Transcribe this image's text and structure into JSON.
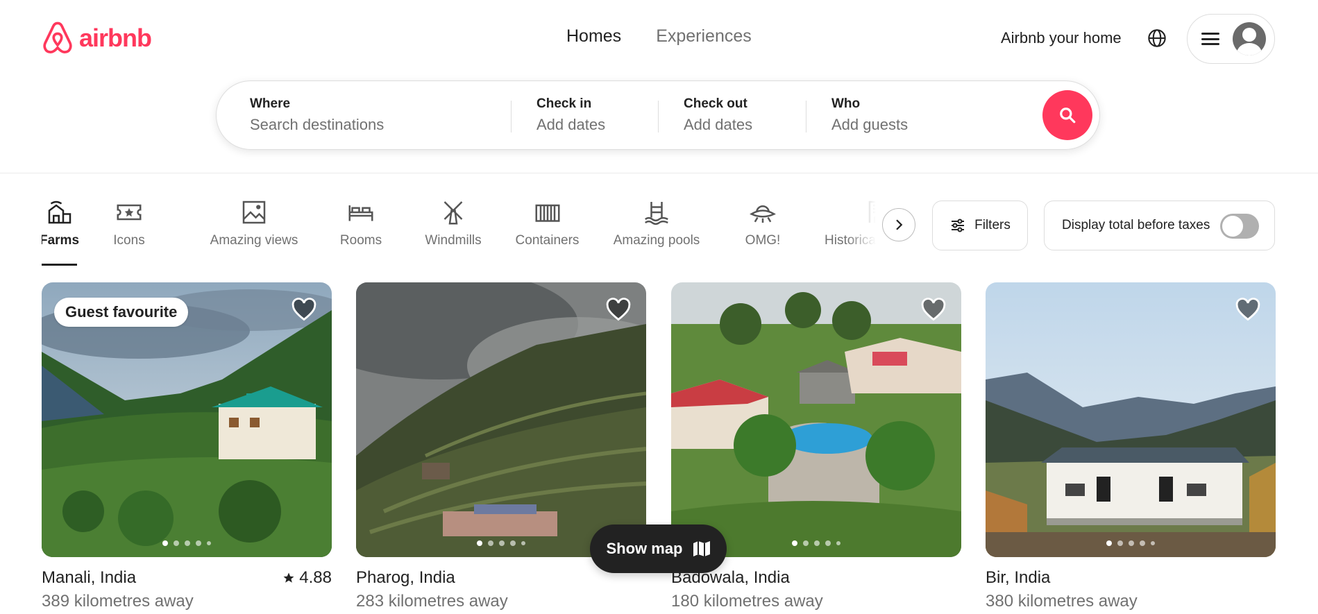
{
  "brand": {
    "name": "airbnb",
    "color": "#ff385c"
  },
  "nav": {
    "tabs": [
      {
        "label": "Homes"
      },
      {
        "label": "Experiences"
      }
    ]
  },
  "header": {
    "host_link": "Airbnb your home",
    "globe_icon": "globe-icon",
    "menu_icon": "hamburger-icon"
  },
  "search": {
    "where": {
      "label": "Where",
      "placeholder": "Search destinations"
    },
    "check_in": {
      "label": "Check in",
      "placeholder": "Add dates"
    },
    "check_out": {
      "label": "Check out",
      "placeholder": "Add dates"
    },
    "who": {
      "label": "Who",
      "placeholder": "Add guests"
    }
  },
  "categories": [
    {
      "label": "Farms",
      "icon": "farm-icon",
      "selected": true
    },
    {
      "label": "Icons",
      "icon": "ticket-star-icon"
    },
    {
      "label": "Amazing views",
      "icon": "framed-picture-icon"
    },
    {
      "label": "Rooms",
      "icon": "bed-icon"
    },
    {
      "label": "Windmills",
      "icon": "windmill-icon"
    },
    {
      "label": "Containers",
      "icon": "container-icon"
    },
    {
      "label": "Amazing pools",
      "icon": "pool-icon"
    },
    {
      "label": "OMG!",
      "icon": "ufo-icon"
    },
    {
      "label": "Historical homes",
      "icon": "historical-building-icon"
    }
  ],
  "filters": {
    "label": "Filters"
  },
  "tax_toggle": {
    "label": "Display total before taxes",
    "on": false
  },
  "listings": [
    {
      "location": "Manali, India",
      "distance": "389 kilometres away",
      "rating": "4.88",
      "badge": "Guest favourite"
    },
    {
      "location": "Pharog, India",
      "distance": "283 kilometres away"
    },
    {
      "location": "Badowala, India",
      "distance": "180 kilometres away"
    },
    {
      "location": "Bir, India",
      "distance": "380 kilometres away"
    }
  ],
  "show_map": {
    "label": "Show map"
  }
}
